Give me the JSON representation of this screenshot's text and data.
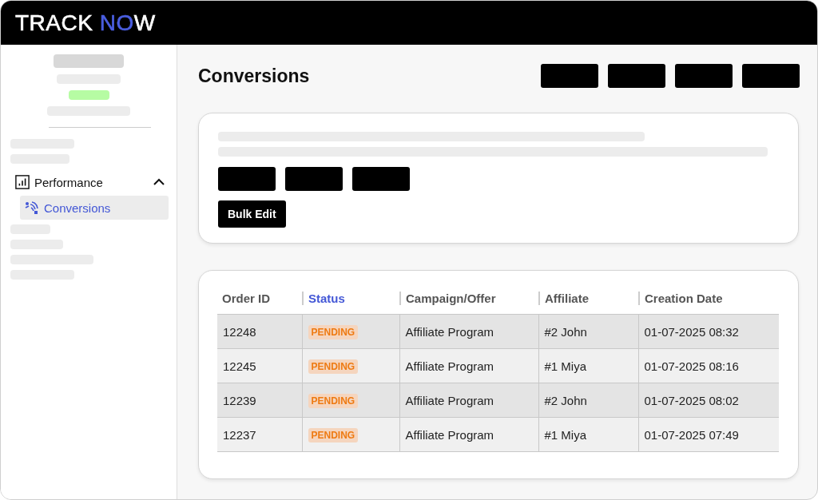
{
  "logo": {
    "parts": [
      {
        "text": "TRACK ",
        "accent": false
      },
      {
        "text": "NO",
        "accent": true
      },
      {
        "text": "W",
        "accent": false
      }
    ]
  },
  "sidebar": {
    "items": [
      {
        "label": "Performance",
        "expanded": true,
        "children": [
          {
            "label": "Conversions",
            "selected": true
          }
        ]
      }
    ]
  },
  "page": {
    "title": "Conversions"
  },
  "filters": {
    "bulk_button": "Bulk Edit"
  },
  "table": {
    "columns": [
      {
        "label": "Order ID",
        "selected": false
      },
      {
        "label": "Status",
        "selected": true
      },
      {
        "label": "Campaign/Offer",
        "selected": false
      },
      {
        "label": "Affiliate",
        "selected": false
      },
      {
        "label": "Creation Date",
        "selected": false
      }
    ],
    "rows": [
      {
        "order_id": "12248",
        "status": "PENDING",
        "campaign": "Affiliate Program",
        "affiliate": "#2 John",
        "date": "01-07-2025 08:32"
      },
      {
        "order_id": "12245",
        "status": "PENDING",
        "campaign": "Affiliate Program",
        "affiliate": "#1 Miya",
        "date": "01-07-2025 08:16"
      },
      {
        "order_id": "12239",
        "status": "PENDING",
        "campaign": "Affiliate Program",
        "affiliate": "#2 John",
        "date": "01-07-2025 08:02"
      },
      {
        "order_id": "12237",
        "status": "PENDING",
        "campaign": "Affiliate Program",
        "affiliate": "#1 Miya",
        "date": "01-07-2025 07:49"
      }
    ]
  }
}
